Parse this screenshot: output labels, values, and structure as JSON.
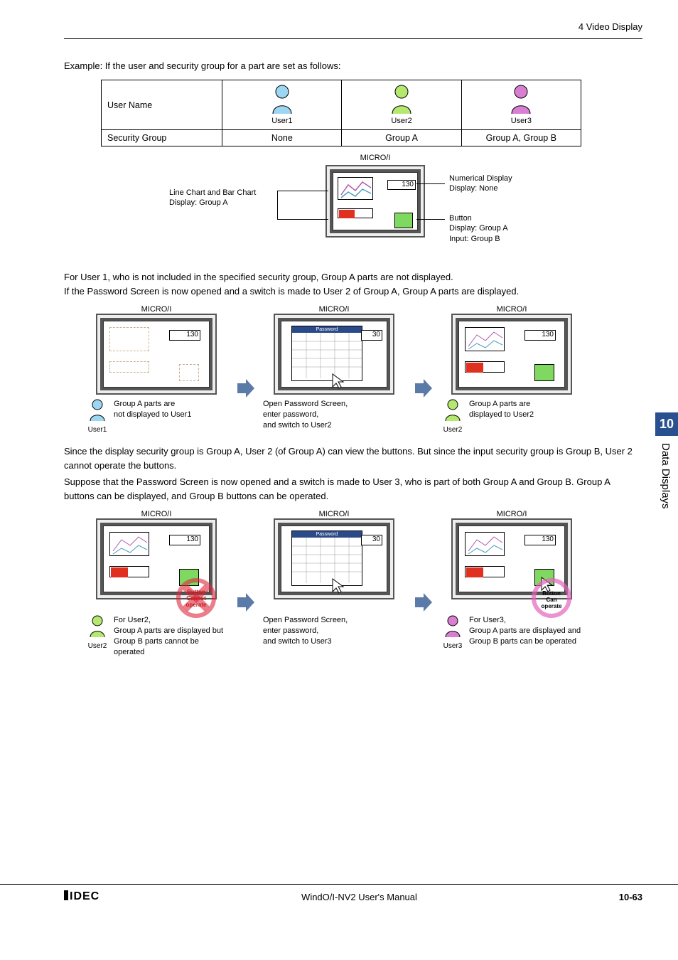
{
  "header": {
    "section": "4 Video Display"
  },
  "intro": "Example: If the user and security group for a part are set as follows:",
  "table": {
    "row1_label": "User Name",
    "row2_label": "Security Group",
    "users": [
      "User1",
      "User2",
      "User3"
    ],
    "groups": [
      "None",
      "Group A",
      "Group A, Group B"
    ]
  },
  "user_colors": [
    "#9dd6f2",
    "#b4e86f",
    "#d97fd2"
  ],
  "diagram1": {
    "title": "MICRO/I",
    "left_label_1": "Line Chart and Bar Chart",
    "left_label_2": "Display: Group A",
    "num_value": "130",
    "right1_a": "Numerical Display",
    "right1_b": "Display: None",
    "right2_a": "Button",
    "right2_b": "Display: Group A",
    "right2_c": "Input: Group B"
  },
  "para1a": "For User 1, who is not included in the specified security group, Group A parts are not displayed.",
  "para1b": "If the Password Screen is now opened and a switch is made to User 2 of Group A, Group A parts are displayed.",
  "seq1": {
    "title": "MICRO/I",
    "num": "130",
    "pw_label": "Password",
    "pw_num": "30",
    "cap1_a": "Group A parts are",
    "cap1_b": "not displayed to User1",
    "cap1_user": "User1",
    "cap2_a": "Open Password Screen,",
    "cap2_b": "enter password,",
    "cap2_c": "and switch to User2",
    "cap3_a": "Group A parts are",
    "cap3_b": "displayed to User2",
    "cap3_user": "User2"
  },
  "para2a": "Since the display security group is Group A, User 2 (of Group A) can view the buttons. But since the input security group is Group B, User 2 cannot operate the buttons.",
  "para2b": "Suppose that the Password Screen is now opened and a switch is made to User 3, who is part of both Group A and Group B. Group A buttons can be displayed, and Group B buttons can be operated.",
  "seq2": {
    "title": "MICRO/I",
    "num": "130",
    "pw_num": "30",
    "badge_cannot_a": "Button",
    "badge_cannot_b": "Cannot operate",
    "badge_can_a": "Button",
    "badge_can_b": "Can operate",
    "cap1_a": "For User2,",
    "cap1_b": "Group A parts are displayed but",
    "cap1_c": "Group B parts cannot be operated",
    "cap1_user": "User2",
    "cap2_a": "Open Password Screen,",
    "cap2_b": "enter password,",
    "cap2_c": "and switch to User3",
    "cap3_a": "For User3,",
    "cap3_b": "Group A parts are displayed and",
    "cap3_c": "Group B parts can be operated",
    "cap3_user": "User3"
  },
  "side": {
    "chapter_num": "10",
    "chapter_title": "Data Displays"
  },
  "footer": {
    "brand": "IDEC",
    "title": "WindO/I-NV2 User's Manual",
    "page": "10-63"
  }
}
